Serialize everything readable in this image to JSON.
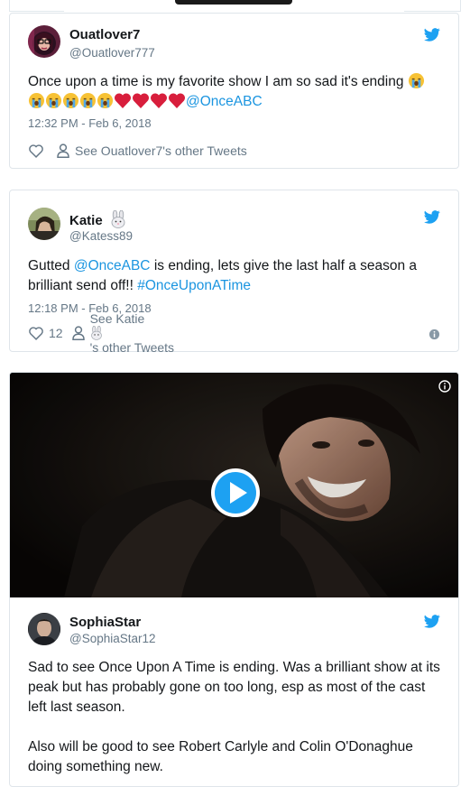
{
  "tweets": [
    {
      "name": "Ouatlover7",
      "handle": "@Ouatlover777",
      "text_plain": "Once upon a time is my favorite show I am so sad it's ending",
      "mention": "@OnceABC",
      "time": "12:32 PM - Feb 6, 2018",
      "likes": "",
      "other_tweets": "See Ouatlover7's other Tweets"
    },
    {
      "name": "Katie",
      "handle": "@Katess89",
      "text_pre": "Gutted",
      "mention": "@OnceABC",
      "text_mid": "is ending, lets give the last half a season a brilliant send off!!",
      "hashtag": "#OnceUponATime",
      "time": "12:18 PM - Feb 6, 2018",
      "likes": "12",
      "other_tweets_pre": "See Katie",
      "other_tweets_post": "'s other Tweets"
    },
    {
      "name": "SophiaStar",
      "handle": "@SophiaStar12",
      "text_p1": "Sad to see Once Upon A Time is ending. Was a brilliant show at its peak but has probably gone on too long, esp as most of the cast left last season.",
      "text_p2": "Also will be good to see Robert Carlyle and Colin O'Donaghue doing something new."
    }
  ],
  "icons": {
    "twitter": "twitter-bird-icon",
    "like": "heart-outline-icon",
    "profile": "person-icon",
    "info": "info-icon",
    "play": "play-icon",
    "sob_emoji": "sob-emoji-icon",
    "heart_emoji": "red-heart-icon",
    "rabbit_emoji": "rabbit-face-icon"
  },
  "colors": {
    "twitter_blue": "#1da1f2",
    "link": "#1b95e0",
    "muted": "#657786",
    "border": "#dfe5ea",
    "heart_red": "#d81e3c"
  }
}
